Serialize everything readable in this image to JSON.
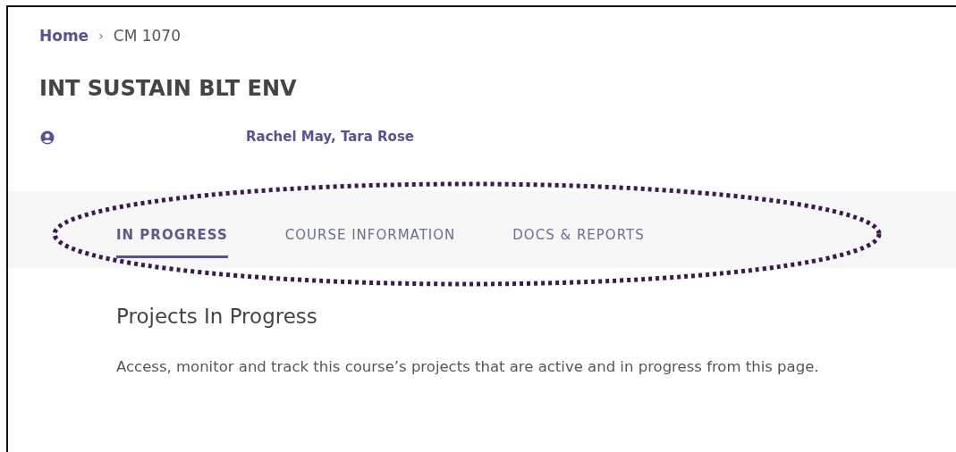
{
  "breadcrumb": [
    {
      "label": "Home",
      "kind": "link"
    },
    {
      "label": "›",
      "kind": "separator"
    },
    {
      "label": "CM 1070",
      "kind": "current"
    }
  ],
  "course_title": "INT SUSTAIN BLT ENV",
  "instructors": "Rachel May, Tara Rose",
  "tabs": [
    {
      "label": "IN PROGRESS",
      "selected": true
    },
    {
      "label": "COURSE INFORMATION",
      "selected": false
    },
    {
      "label": "DOCS & REPORTS",
      "selected": false
    }
  ],
  "section": {
    "heading": "Projects In Progress",
    "description": "Access, monitor and track this course’s projects that are active and in progress from this page."
  }
}
